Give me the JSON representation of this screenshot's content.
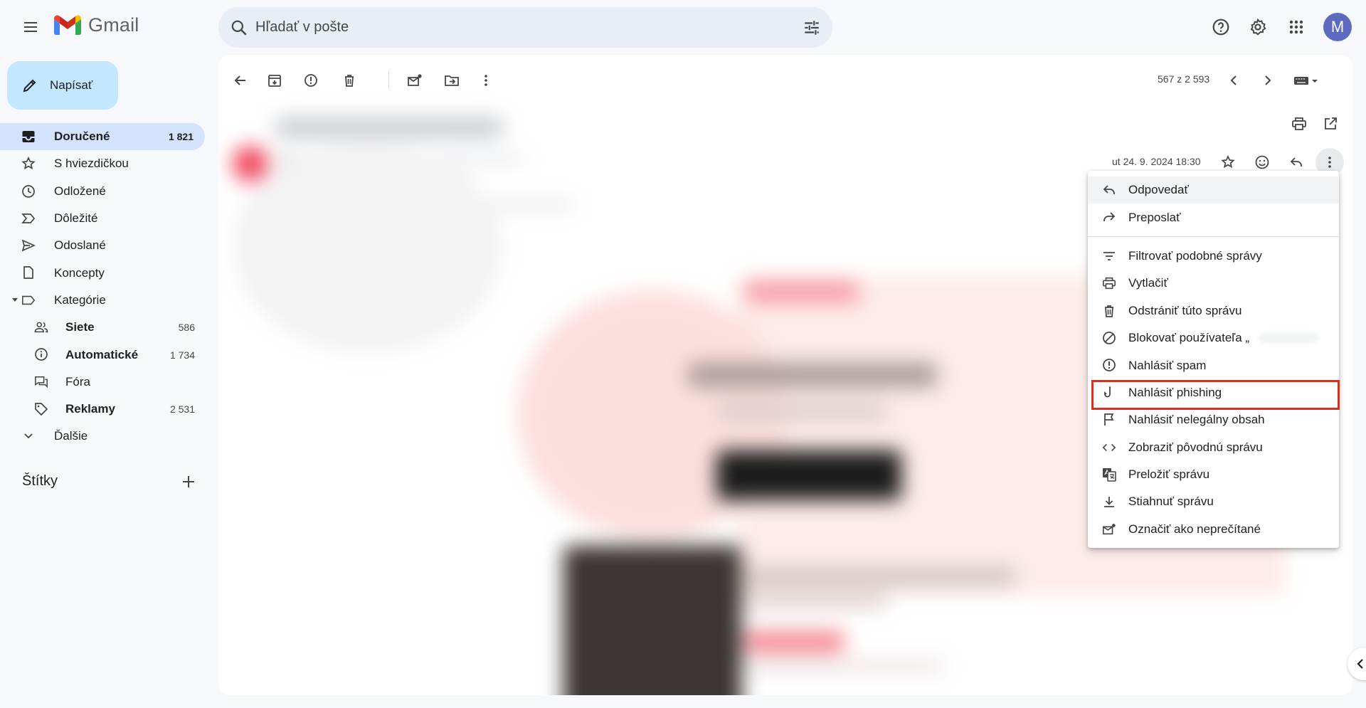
{
  "app": {
    "name": "Gmail",
    "avatar_letter": "M"
  },
  "search": {
    "placeholder": "Hľadať v pošte"
  },
  "compose": {
    "label": "Napísať"
  },
  "sidebar": {
    "items": [
      {
        "label": "Doručené",
        "count": "1 821",
        "icon": "inbox-icon"
      },
      {
        "label": "S hviezdičkou",
        "count": "",
        "icon": "star-icon"
      },
      {
        "label": "Odložené",
        "count": "",
        "icon": "clock-icon"
      },
      {
        "label": "Dôležité",
        "count": "",
        "icon": "important-icon"
      },
      {
        "label": "Odoslané",
        "count": "",
        "icon": "send-icon"
      },
      {
        "label": "Koncepty",
        "count": "",
        "icon": "draft-icon"
      },
      {
        "label": "Kategórie",
        "count": "",
        "icon": "label-icon"
      },
      {
        "label": "Siete",
        "count": "586",
        "icon": "people-icon"
      },
      {
        "label": "Automatické",
        "count": "1 734",
        "icon": "info-icon"
      },
      {
        "label": "Fóra",
        "count": "",
        "icon": "forum-icon"
      },
      {
        "label": "Reklamy",
        "count": "2 531",
        "icon": "tag-icon"
      },
      {
        "label": "Ďalšie",
        "count": "",
        "icon": "expand-icon"
      }
    ],
    "labels_header": "Štítky"
  },
  "toolbar": {
    "pager": "567 z 2 593"
  },
  "message": {
    "date": "ut 24. 9. 2024 18:30"
  },
  "menu": {
    "items": [
      {
        "label": "Odpovedať",
        "icon": "reply-icon"
      },
      {
        "label": "Preposlať",
        "icon": "forward-icon"
      },
      {
        "label": "Filtrovať podobné správy",
        "icon": "filter-icon"
      },
      {
        "label": "Vytlačiť",
        "icon": "print-icon"
      },
      {
        "label": "Odstrániť túto správu",
        "icon": "trash-icon"
      },
      {
        "label": "Blokovať používateľa „",
        "icon": "block-icon"
      },
      {
        "label": "Nahlásiť spam",
        "icon": "report-icon"
      },
      {
        "label": "Nahlásiť phishing",
        "icon": "phishing-hook-icon"
      },
      {
        "label": "Nahlásiť nelegálny obsah",
        "icon": "flag-icon"
      },
      {
        "label": "Zobraziť pôvodnú správu",
        "icon": "code-icon"
      },
      {
        "label": "Preložiť správu",
        "icon": "translate-icon"
      },
      {
        "label": "Stiahnuť správu",
        "icon": "download-icon"
      },
      {
        "label": "Označiť ako neprečítané",
        "icon": "mark-unread-icon"
      }
    ],
    "highlighted": "Nahlásiť phishing"
  },
  "colors": {
    "accent": "#c2e7ff",
    "active_nav": "#d3e3fd",
    "highlight": "#d93025",
    "avatar": "#5c6bc0"
  }
}
